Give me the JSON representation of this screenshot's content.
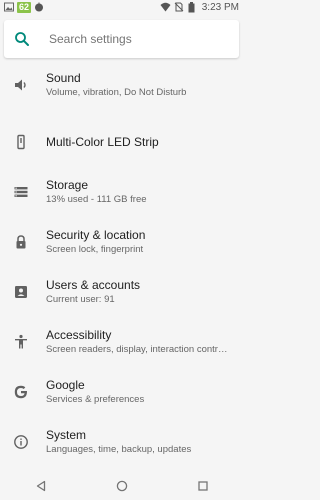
{
  "status_bar": {
    "battery_level": "62",
    "time": "3:23 PM"
  },
  "search": {
    "placeholder": "Search settings"
  },
  "settings": [
    {
      "key": "sound",
      "icon": "speaker-icon",
      "title": "Sound",
      "subtitle": "Volume, vibration, Do Not Disturb"
    },
    {
      "key": "led",
      "icon": "led-strip-icon",
      "title": "Multi-Color LED Strip",
      "subtitle": ""
    },
    {
      "key": "storage",
      "icon": "storage-icon",
      "title": "Storage",
      "subtitle": "13% used - 111 GB free"
    },
    {
      "key": "security",
      "icon": "lock-icon",
      "title": "Security & location",
      "subtitle": "Screen lock, fingerprint"
    },
    {
      "key": "users",
      "icon": "account-icon",
      "title": "Users & accounts",
      "subtitle": "Current user: 91"
    },
    {
      "key": "accessibility",
      "icon": "accessibility-icon",
      "title": "Accessibility",
      "subtitle": "Screen readers, display, interaction contr…"
    },
    {
      "key": "google",
      "icon": "google-icon",
      "title": "Google",
      "subtitle": "Services & preferences"
    },
    {
      "key": "system",
      "icon": "info-icon",
      "title": "System",
      "subtitle": "Languages, time, backup, updates"
    }
  ],
  "colors": {
    "accent": "#00897b",
    "background": "#f5f5f5",
    "battery_badge": "#8bc34a"
  }
}
